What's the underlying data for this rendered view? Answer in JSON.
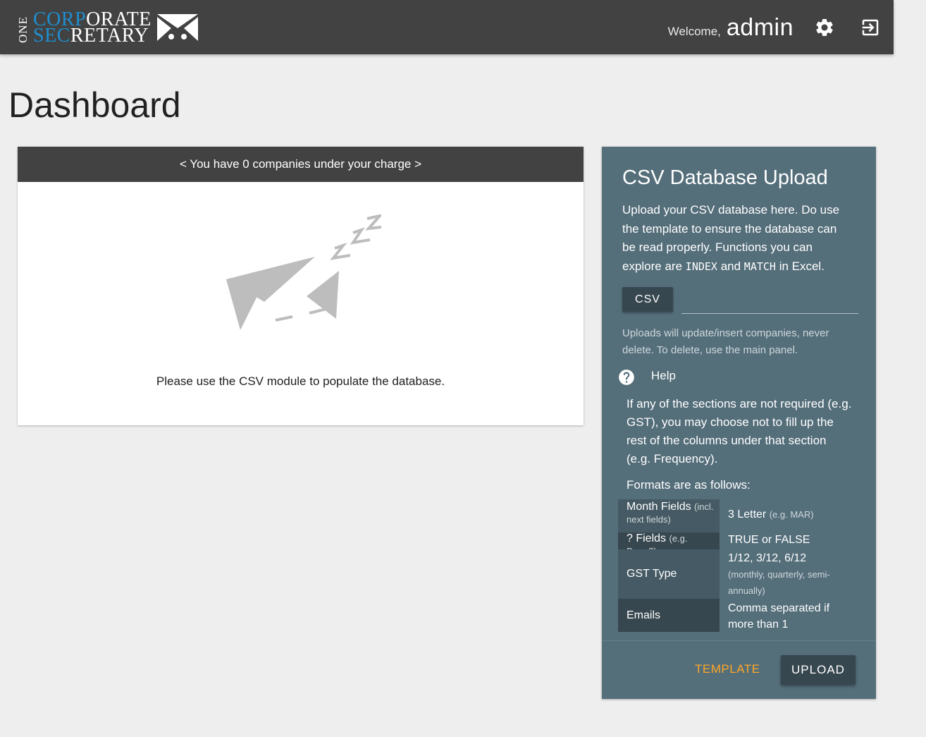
{
  "header": {
    "logo": {
      "one": "ONE",
      "line1_hl": "CORP",
      "line1_rest": "ORATE",
      "line2_hl": "SEC",
      "line2_rest": "RETARY",
      "icon": "envelope-logo-icon"
    },
    "welcome_label": "Welcome,",
    "username": "admin",
    "settings_icon": "gear-icon",
    "logout_icon": "logout-icon"
  },
  "page": {
    "title": "Dashboard"
  },
  "companies_card": {
    "header": "< You have 0 companies under your charge >",
    "illustration_icon": "sleeping-envelope-icon",
    "empty_message": "Please use the CSV module to populate the database."
  },
  "csv_card": {
    "title": "CSV Database Upload",
    "desc_part1": "Upload your CSV database here. Do use the template to ensure the database can be read properly. Functions you can explore are",
    "desc_code1": "INDEX",
    "desc_and": "and",
    "desc_code2": "MATCH",
    "desc_part2": "in Excel.",
    "csv_button": "CSV",
    "file_path_value": "",
    "note": "Uploads will update/insert companies, never delete. To delete, use the main panel.",
    "help_label": "Help",
    "help_icon": "help-circle-icon",
    "help_text": "If any of the sections are not required (e.g. GST), you may choose not to fill up the rest of the columns under that section (e.g. Frequency).",
    "formats_label": "Formats are as follows:",
    "formats": [
      {
        "key": "Month Fields",
        "key_note": "(incl. next fields)",
        "value": "3 Letter",
        "value_note": "(e.g. MAR)"
      },
      {
        "key": "? Fields",
        "key_note": "(e.g. Done?)",
        "value": "TRUE or FALSE",
        "value_note": ""
      },
      {
        "key": "GST Type",
        "key_note": "",
        "value": "1/12, 3/12, 6/12",
        "value_note": "(monthly, quarterly, semi-annually)"
      },
      {
        "key": "Emails",
        "key_note": "",
        "value": "Comma separated if more than 1",
        "value_note": ""
      }
    ],
    "template_button": "TEMPLATE",
    "upload_button": "UPLOAD"
  },
  "colors": {
    "topbar": "#424242",
    "card_header": "#424242",
    "csv_card_bg": "#546e7a",
    "dark_button": "#37474f",
    "template_accent": "#ffa726",
    "logo_accent": "#1e8fd0",
    "page_bg": "#eeeeee"
  }
}
